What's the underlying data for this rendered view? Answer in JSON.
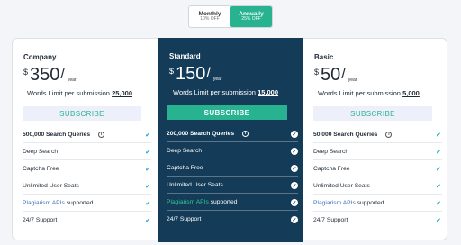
{
  "billing_toggle": {
    "monthly": {
      "label": "Monthly",
      "discount": "10% OFF"
    },
    "annually": {
      "label": "Annually",
      "discount": "25% OFF",
      "selected": true
    }
  },
  "colors": {
    "accent": "#27b38f",
    "highlight_card": "#143b57",
    "link": "#3a73b8",
    "check": "#1aa5c9"
  },
  "plans": [
    {
      "name": "Company",
      "currency": "$",
      "price": "350",
      "slash": "/",
      "period": "year",
      "limit_label": "Words Limit per submission",
      "limit_value": "25,000",
      "button": "SUBSCRIBE",
      "features": [
        {
          "text": "500,000 Search Queries",
          "info": "i"
        },
        {
          "text": "Deep Search"
        },
        {
          "text": "Captcha Free"
        },
        {
          "text": "Unlimited User Seats"
        },
        {
          "link": "Plagiarism APIs",
          "text": " supported"
        },
        {
          "text": "24/7 Support"
        }
      ]
    },
    {
      "name": "Standard",
      "currency": "$",
      "price": "150",
      "slash": "/",
      "period": "year",
      "limit_label": "Words Limit per submission",
      "limit_value": "15,000",
      "button": "SUBSCRIBE",
      "features": [
        {
          "text": "200,000 Search Queries",
          "info": "i"
        },
        {
          "text": "Deep Search"
        },
        {
          "text": "Captcha Free"
        },
        {
          "text": "Unlimited User Seats"
        },
        {
          "link": "Plagiarism APIs",
          "text": " supported"
        },
        {
          "text": "24/7 Support"
        }
      ]
    },
    {
      "name": "Basic",
      "currency": "$",
      "price": "50",
      "slash": "/",
      "period": "year",
      "limit_label": "Words Limit per submission",
      "limit_value": "5,000",
      "button": "SUBSCRIBE",
      "features": [
        {
          "text": "50,000 Search Queries",
          "info": "i"
        },
        {
          "text": "Deep Search"
        },
        {
          "text": "Captcha Free"
        },
        {
          "text": "Unlimited User Seats"
        },
        {
          "link": "Plagiarism APIs",
          "text": " supported"
        },
        {
          "text": "24/7 Support"
        }
      ]
    }
  ]
}
